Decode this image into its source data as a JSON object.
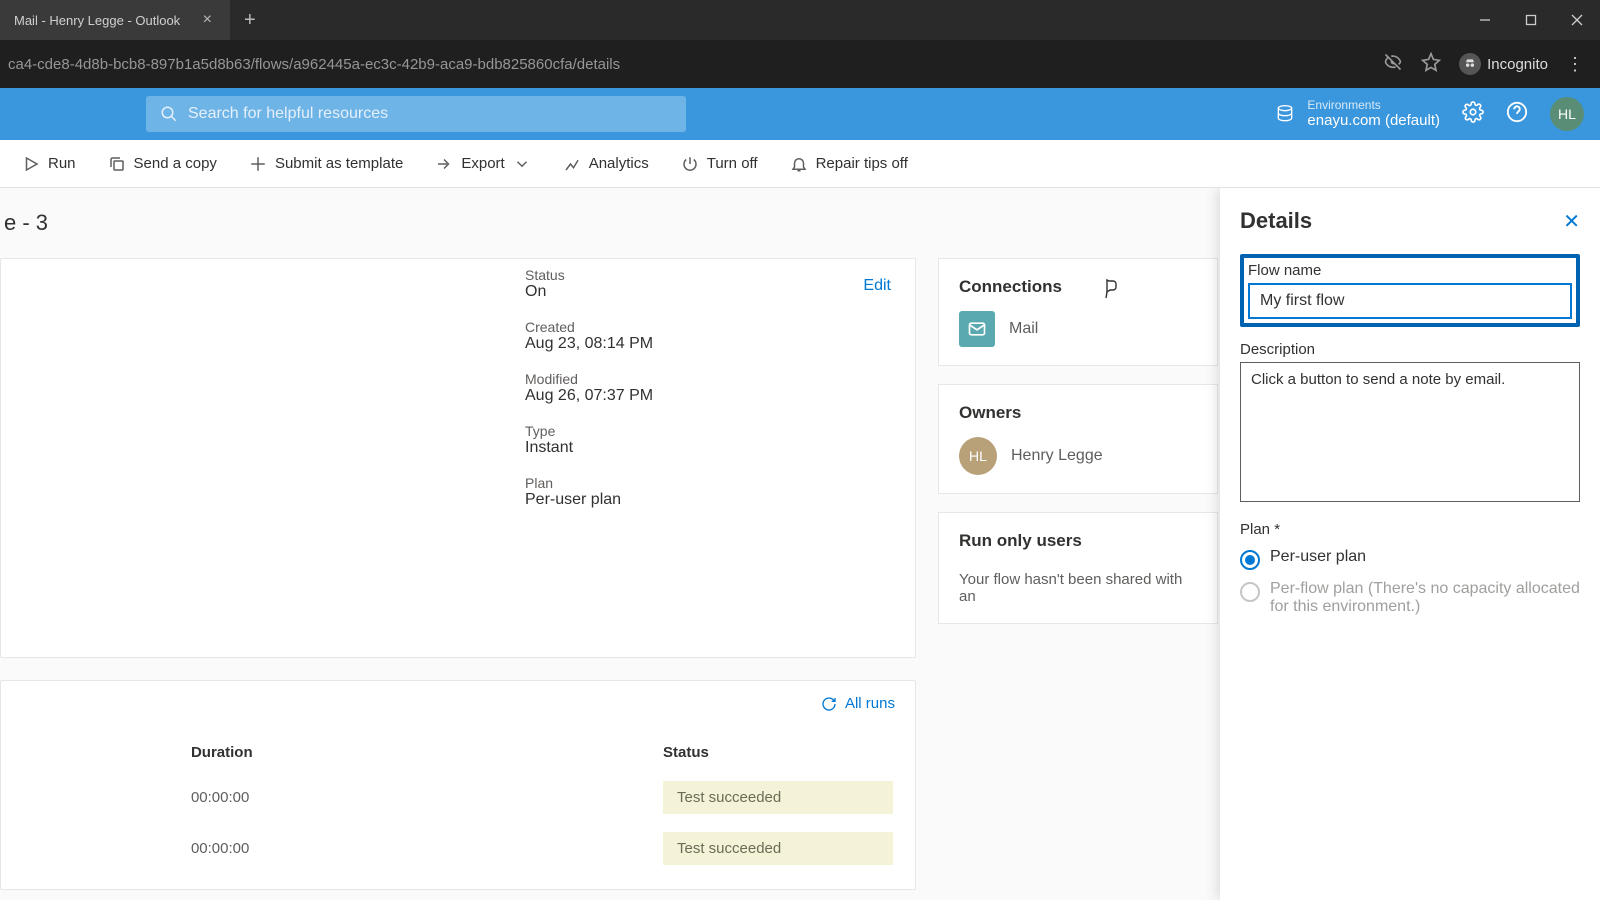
{
  "browser": {
    "tab_title": "Mail - Henry Legge - Outlook",
    "url": "ca4-cde8-4d8b-bcb8-897b1a5d8b63/flows/a962445a-ec3c-42b9-aca9-bdb825860cfa/details",
    "incognito": "Incognito"
  },
  "header": {
    "search_placeholder": "Search for helpful resources",
    "env_label": "Environments",
    "env_name": "enayu.com (default)",
    "avatar": "HL"
  },
  "commands": {
    "run": "Run",
    "send_copy": "Send a copy",
    "submit_template": "Submit as template",
    "export": "Export",
    "analytics": "Analytics",
    "turn_off": "Turn off",
    "repair_tips": "Repair tips off"
  },
  "page": {
    "title": "e - 3"
  },
  "details_card": {
    "edit": "Edit",
    "status_k": "Status",
    "status_v": "On",
    "created_k": "Created",
    "created_v": "Aug 23, 08:14 PM",
    "modified_k": "Modified",
    "modified_v": "Aug 26, 07:37 PM",
    "type_k": "Type",
    "type_v": "Instant",
    "plan_k": "Plan",
    "plan_v": "Per-user plan"
  },
  "connections": {
    "heading": "Connections",
    "item": "Mail"
  },
  "owners": {
    "heading": "Owners",
    "initials": "HL",
    "name": "Henry Legge"
  },
  "runonly": {
    "heading": "Run only users",
    "text": "Your flow hasn't been shared with an"
  },
  "runs": {
    "all_runs": "All runs",
    "col_duration": "Duration",
    "col_status": "Status",
    "rows": [
      {
        "duration": "00:00:00",
        "status": "Test succeeded"
      },
      {
        "duration": "00:00:00",
        "status": "Test succeeded"
      }
    ]
  },
  "panel": {
    "title": "Details",
    "flowname_label": "Flow name",
    "flowname_value": "My first flow",
    "desc_label": "Description",
    "desc_value": "Click a button to send a note by email.",
    "plan_label": "Plan *",
    "plan_per_user": "Per-user plan",
    "plan_per_flow": "Per-flow plan (There's no capacity allocated for this environment.)"
  }
}
